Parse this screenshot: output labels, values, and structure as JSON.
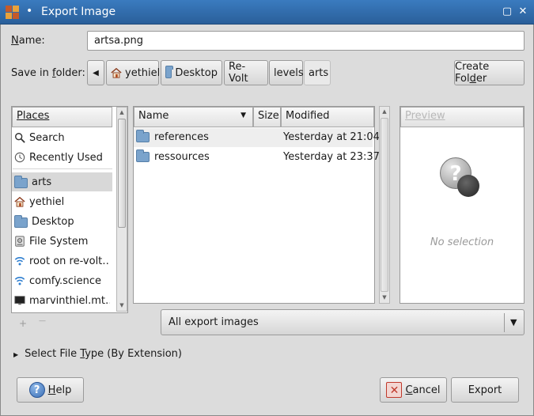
{
  "window": {
    "title": "Export Image",
    "dot": "•",
    "restore_glyph": "▢",
    "close_glyph": "✕"
  },
  "name_field": {
    "label_prefix": "N",
    "label_rest": "ame:",
    "value": "artsa.png"
  },
  "folder": {
    "label_prefix": "Save in ",
    "label_mnemonic": "f",
    "label_rest": "older:",
    "back_glyph": "◀",
    "breadcrumbs": [
      "yethiel",
      "Desktop",
      "Re-Volt",
      "levels",
      "arts"
    ],
    "create_folder": {
      "pre": "Create Fol",
      "mnemonic": "d",
      "post": "er"
    }
  },
  "places": {
    "header": "Places",
    "items": [
      "Search",
      "Recently Used",
      "arts",
      "yethiel",
      "Desktop",
      "File System",
      "root on re-volt…",
      "comfy.science",
      "marvinthiel.mt…"
    ],
    "add_glyph": "+",
    "remove_glyph": "—"
  },
  "files": {
    "columns": {
      "name": "Name",
      "size": "Size",
      "modified": "Modified"
    },
    "rows": [
      {
        "name": "references",
        "size": "",
        "modified": "Yesterday at 21:04"
      },
      {
        "name": "ressources",
        "size": "",
        "modified": "Yesterday at 23:37"
      }
    ]
  },
  "preview": {
    "header": "Preview",
    "empty_text": "No selection",
    "icon_glyph": "?"
  },
  "filter": {
    "value": "All export images",
    "arrow_glyph": "▼"
  },
  "filetype": {
    "arrow_glyph": "▶",
    "pre": "Select File ",
    "mnemonic": "T",
    "post": "ype (By Extension)"
  },
  "buttons": {
    "help": {
      "mnemonic": "H",
      "rest": "elp",
      "icon_glyph": "?"
    },
    "cancel": {
      "mnemonic": "C",
      "rest": "ancel",
      "icon_glyph": "✕"
    },
    "export": "Export"
  },
  "colors": {
    "titlebar": "#2f6aa8",
    "selection": "#d8d8d8",
    "folder": "#7aa3cc",
    "cancel_red": "#c0392b",
    "help_blue": "#3b6fb6"
  }
}
